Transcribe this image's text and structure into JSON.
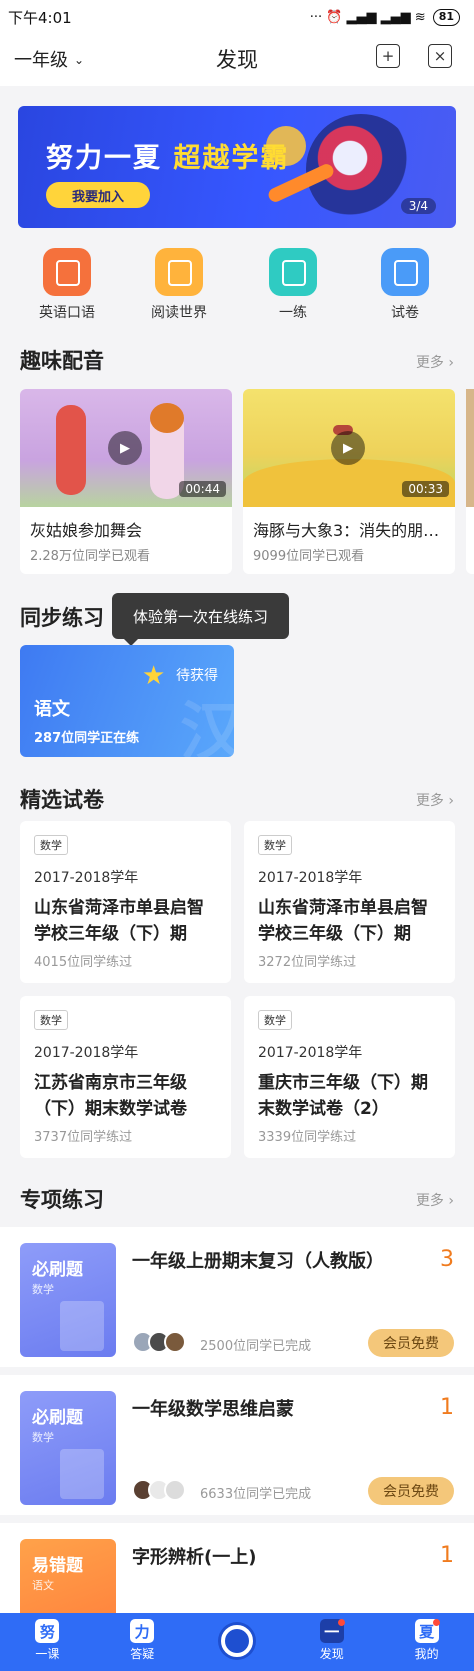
{
  "status": {
    "time": "下午4:01",
    "icons": "··· ⏰ ▂▄▆ ▂▄▆ ≋",
    "battery": "81"
  },
  "header": {
    "grade": "一年级",
    "grade_chevron": "⌄",
    "title": "发现",
    "icon1": "+",
    "icon2": "×"
  },
  "banner": {
    "text_a": "努力一夏 ",
    "text_b": "超越学霸",
    "join": "我要加入",
    "page": "3/4"
  },
  "categories": [
    {
      "label": "英语口语",
      "color": "#f5713c"
    },
    {
      "label": "阅读世界",
      "color": "#ffb33c"
    },
    {
      "label": "一练",
      "color": "#2fcbc2"
    },
    {
      "label": "试卷",
      "color": "#4a9bf8"
    }
  ],
  "dubbing": {
    "title": "趣味配音",
    "more": "更多 ›",
    "play": "▶",
    "videos": [
      {
        "title": "灰姑娘参加舞会",
        "views": "2.28万位同学已观看",
        "duration": "00:44"
      },
      {
        "title": "海豚与大象3：消失的朋…",
        "views": "9099位同学已观看",
        "duration": "00:33"
      }
    ]
  },
  "sync": {
    "title": "同步练习",
    "tooltip": "体验第一次在线练习",
    "card": {
      "star": "★",
      "earn": "待获得",
      "subject": "语文",
      "count": "287位同学正在练",
      "watermark": "汉"
    }
  },
  "papers": {
    "title": "精选试卷",
    "more": "更多 ›",
    "items": [
      {
        "tag": "数学",
        "year": "2017-2018学年",
        "name": "山东省菏泽市单县启智学校三年级（下）期末…",
        "count": "4015位同学练过"
      },
      {
        "tag": "数学",
        "year": "2017-2018学年",
        "name": "山东省菏泽市单县启智学校三年级（下）期末…",
        "count": "3272位同学练过"
      },
      {
        "tag": "数学",
        "year": "2017-2018学年",
        "name": "江苏省南京市三年级（下）期末数学试卷",
        "count": "3737位同学练过"
      },
      {
        "tag": "数学",
        "year": "2017-2018学年",
        "name": "重庆市三年级（下）期末数学试卷（2）",
        "count": "3339位同学练过"
      }
    ]
  },
  "special": {
    "title": "专项练习",
    "more": "更多 ›",
    "items": [
      {
        "thumb_title": "必刷题",
        "thumb_sub": "数学",
        "title": "一年级上册期末复习（人教版）",
        "num": "3",
        "done": "2500位同学已完成",
        "vip": "会员免费"
      },
      {
        "thumb_title": "必刷题",
        "thumb_sub": "数学",
        "title": "一年级数学思维启蒙",
        "num": "1",
        "done": "6633位同学已完成",
        "vip": "会员免费"
      },
      {
        "thumb_title": "易错题",
        "thumb_sub": "语文",
        "title": "字形辨析(一上)",
        "num": "1"
      }
    ]
  },
  "tabs": [
    {
      "label": "一课",
      "glyph": "努"
    },
    {
      "label": "答疑",
      "glyph": "力"
    },
    {
      "label": "",
      "glyph": ""
    },
    {
      "label": "发现",
      "glyph": "一"
    },
    {
      "label": "我的",
      "glyph": "夏"
    }
  ],
  "colors": {
    "accent": "#2f6cf6",
    "orange": "#f07b1e",
    "vip_bg": "#f4c77a"
  }
}
